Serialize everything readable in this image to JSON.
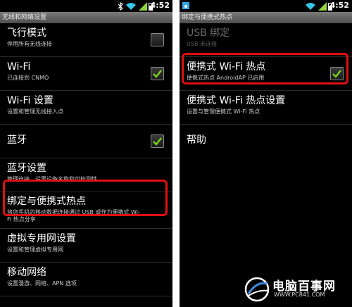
{
  "left": {
    "status_time": "4:52",
    "title": "无线和网络设置",
    "items": [
      {
        "title": "飞行模式",
        "summary": "停用所有无线连接",
        "checked": false
      },
      {
        "title": "Wi-Fi",
        "summary": "已连接到 CNMO",
        "checked": true
      },
      {
        "title": "Wi-Fi 设置",
        "summary": "设置和管理无线接入点"
      },
      {
        "title": "蓝牙",
        "checked": true
      },
      {
        "title": "蓝牙设置",
        "summary": "管理连接、设置设备名称和可检测性"
      },
      {
        "title": "绑定与便携式热点",
        "summary": "将您手机的移动数据连接通过 USB 或作为便携式 Wi-Fi 热点分享"
      },
      {
        "title": "虚拟专用网设置",
        "summary": "设置和管理虚拟专用网"
      },
      {
        "title": "移动网络",
        "summary": "设置漫游、网络、APN 选项"
      }
    ]
  },
  "right": {
    "status_time": "4:52",
    "title": "绑定与便携式热点",
    "items": [
      {
        "title": "USB 绑定",
        "summary": "USB 未连接",
        "disabled": true
      },
      {
        "title": "便携式 Wi-Fi 热点",
        "summary": "便携式热点 AndroidAP 已启用",
        "checked": true
      },
      {
        "title": "便携式 Wi-Fi 热点设置",
        "summary": "设置与管理便携式 Wi-Fi 热点"
      },
      {
        "title": "帮助"
      }
    ]
  },
  "watermark": {
    "brand": "电脑百事网",
    "url": "WWW.PC841.COM"
  },
  "colors": {
    "highlight": "#e01010",
    "check": "#7ed321",
    "titlebar": "#5a5a5a"
  }
}
